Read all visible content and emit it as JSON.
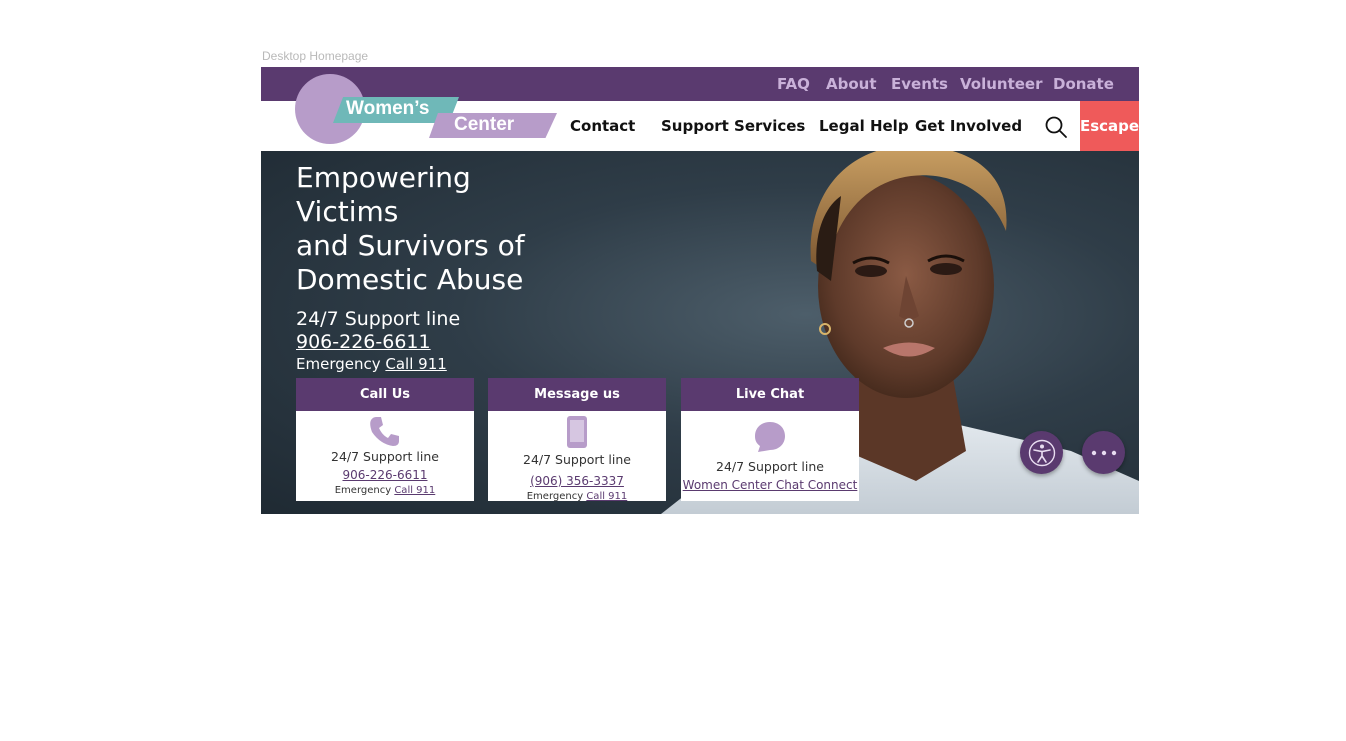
{
  "frame_label": "Desktop Homepage",
  "colors": {
    "brand_purple": "#5a3a6f",
    "light_purple": "#b79cc9",
    "teal": "#6fb8b8",
    "escape_red": "#ef5a5a"
  },
  "utility_nav": [
    "FAQ",
    "About",
    "Events",
    "Volunteer",
    "Donate"
  ],
  "logo": {
    "line1": "Women’s",
    "line2": "Center"
  },
  "main_nav": [
    "Contact",
    "Support Services",
    "Legal Help",
    "Get Involved"
  ],
  "search": {
    "icon": "search-icon"
  },
  "escape_label": "Escape",
  "hero": {
    "title_lines": [
      "Empowering",
      "Victims",
      "and Survivors of",
      "Domestic Abuse"
    ],
    "support_label": "24/7 Support line",
    "phone": "906-226-6611",
    "emergency_prefix": "Emergency",
    "emergency_link": "Call 911"
  },
  "cards": [
    {
      "header": "Call Us",
      "icon": "phone-icon",
      "line": "24/7 Support line",
      "link": "906-226-6611",
      "emergency_prefix": "Emergency",
      "emergency_link": "Call 911"
    },
    {
      "header": "Message us",
      "icon": "mobile-icon",
      "line": "24/7 Support line",
      "link": "(906) 356-3337",
      "emergency_prefix": "Emergency",
      "emergency_link": "Call 911"
    },
    {
      "header": "Live Chat",
      "icon": "chat-bubble-icon",
      "line": "24/7 Support line",
      "link": "Women Center Chat Connect"
    }
  ],
  "floating": {
    "accessibility_icon": "accessibility-icon",
    "chat_icon": "chat-dots-icon"
  }
}
